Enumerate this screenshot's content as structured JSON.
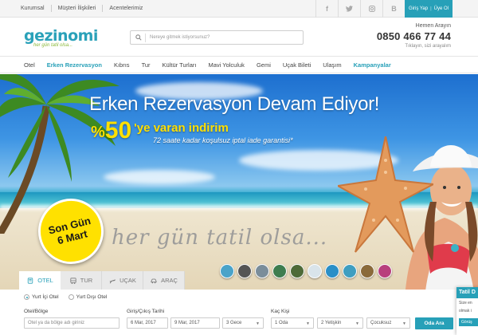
{
  "topbar": {
    "links": [
      "Kurumsal",
      "Müşteri İlişkileri",
      "Acentelerimiz"
    ],
    "social_icons": [
      "facebook-icon",
      "twitter-icon",
      "instagram-icon",
      "blog-icon"
    ],
    "login": "Giriş Yap",
    "register": "Üye Ol"
  },
  "header": {
    "brand": "gezinomi",
    "tagline": "her gün tatil olsa...",
    "search_placeholder": "Nereye gitmek istiyorsunuz?",
    "contact_label": "Hemen Arayın",
    "phone": "0850 466 77 44",
    "contact_sub": "Tıklayın, sizi arayalım"
  },
  "nav": {
    "items": [
      "Otel",
      "Erken Rezervasyon",
      "Kıbrıs",
      "Tur",
      "Kültür Turları",
      "Mavi Yolculuk",
      "Gemi",
      "Uçak Bileti",
      "Ulaşım",
      "Kampanyalar"
    ]
  },
  "hero": {
    "headline": "Erken Rezervasyon Devam Ediyor!",
    "discount_symbol": "%",
    "discount_value": "50",
    "discount_text": "'ye varan indirim",
    "subline": "72 saate kadar koşulsuz iptal iade garantisi*",
    "badge_line1": "Son Gün",
    "badge_line2": "6 Mart",
    "script": "her gün tatil olsa..."
  },
  "tabs": [
    {
      "label": "OTEL",
      "icon": "hotel-icon"
    },
    {
      "label": "TUR",
      "icon": "bus-icon"
    },
    {
      "label": "UÇAK",
      "icon": "plane-icon"
    },
    {
      "label": "ARAÇ",
      "icon": "car-icon"
    }
  ],
  "form": {
    "radio_domestic": "Yurt İçi Otel",
    "radio_abroad": "Yurt Dışı Otel",
    "hotel_label": "Otel/Bölge",
    "hotel_placeholder": "Otel ya da bölge adı giriniz",
    "dates_label": "Giriş/Çıkış Tarihi",
    "checkin": "6 Mar, 2017",
    "checkout": "9 Mar, 2017",
    "nights": "3 Gece",
    "guests_label": "Kaç Kişi",
    "rooms": "1 Oda",
    "adults": "2 Yetişkin",
    "children": "Çocuksuz",
    "search_button": "Oda Ara"
  },
  "chat": {
    "title": "Tatil D",
    "body1": "Size en",
    "body2": "olmak i",
    "button": "Görüş"
  },
  "colors": {
    "accent": "#27a0b8",
    "promo_yellow": "#ffe000",
    "tagline_green": "#8bb93a"
  }
}
